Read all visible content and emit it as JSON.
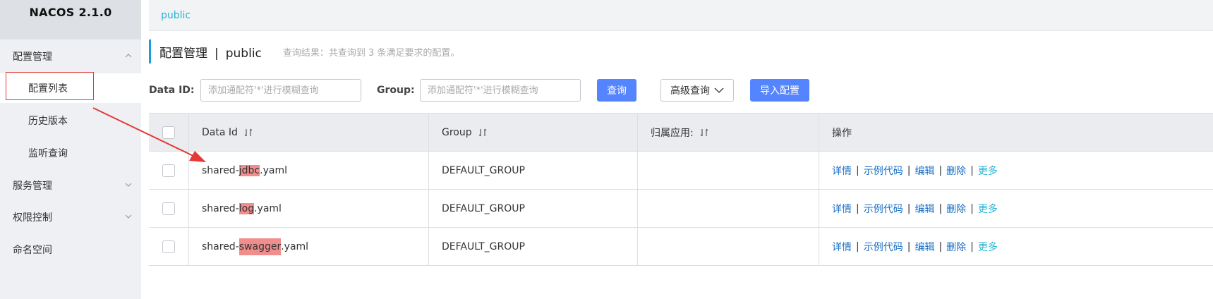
{
  "app": {
    "logo": "NACOS 2.1.0"
  },
  "sidebar": {
    "groups": [
      {
        "label": "配置管理",
        "expanded": true,
        "items": [
          {
            "label": "配置列表",
            "active": true
          },
          {
            "label": "历史版本"
          },
          {
            "label": "监听查询"
          }
        ]
      },
      {
        "label": "服务管理",
        "expanded": false
      },
      {
        "label": "权限控制",
        "expanded": false
      },
      {
        "label": "命名空间"
      }
    ]
  },
  "topbar": {
    "namespace": "public"
  },
  "header": {
    "title": "配置管理",
    "separator": "|",
    "namespace": "public",
    "result_text": "查询结果：共查询到 3 条满足要求的配置。"
  },
  "search": {
    "data_id_label": "Data ID:",
    "data_id_placeholder": "添加通配符'*'进行模糊查询",
    "group_label": "Group:",
    "group_placeholder": "添加通配符'*'进行模糊查询",
    "query_button": "查询",
    "advanced_button": "高级查询",
    "import_button": "导入配置"
  },
  "table": {
    "columns": [
      "Data Id",
      "Group",
      "归属应用:",
      "操作"
    ],
    "rows": [
      {
        "data_id_prefix": "shared-",
        "data_id_highlight": "jdbc",
        "data_id_suffix": ".yaml",
        "group": "DEFAULT_GROUP",
        "app": ""
      },
      {
        "data_id_prefix": "shared-",
        "data_id_highlight": "log",
        "data_id_suffix": ".yaml",
        "group": "DEFAULT_GROUP",
        "app": ""
      },
      {
        "data_id_prefix": "shared-",
        "data_id_highlight": "swagger",
        "data_id_suffix": ".yaml",
        "group": "DEFAULT_GROUP",
        "app": ""
      }
    ],
    "actions": {
      "details": "详情",
      "sample_code": "示例代码",
      "edit": "编辑",
      "delete": "删除",
      "more": "更多",
      "separator": "|"
    }
  },
  "colors": {
    "primary": "#5584ff",
    "link": "#1a6fc4",
    "accent": "#27b3d4",
    "annotation": "#e53935",
    "highlight": "#f08d8d"
  }
}
